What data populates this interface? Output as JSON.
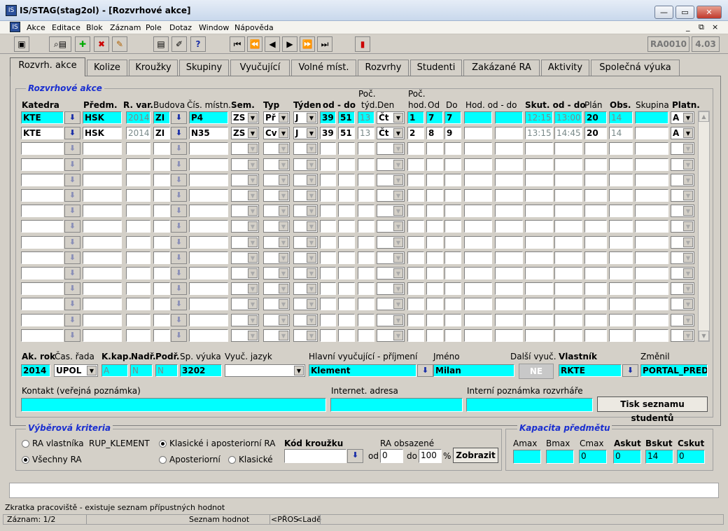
{
  "window": {
    "title": "IS/STAG(stag2ol) - [Rozvrhové akce]"
  },
  "menu": [
    "Akce",
    "Editace",
    "Blok",
    "Záznam",
    "Pole",
    "Dotaz",
    "Window",
    "Nápověda"
  ],
  "toolbar": {
    "form_code": "RA0010",
    "version": "4.03"
  },
  "tabs": [
    "Rozvrh. akce",
    "Kolize",
    "Kroužky",
    "Skupiny",
    "Vyučující",
    "Volné míst.",
    "Rozvrhy",
    "Studenti",
    "Zakázané RA",
    "Aktivity",
    "Společná výuka"
  ],
  "section": {
    "title": "Rozvrhové akce"
  },
  "columns": {
    "katedra": "Katedra",
    "predm": "Předm.",
    "rvar": "R. var.",
    "budova": "Budova",
    "cis_mistn": "Čís. místn.",
    "sem": "Sem.",
    "typ": "Typ",
    "tyden": "Týden",
    "od_do": "od - do",
    "poc_tyd_1": "Poč.",
    "poc_tyd_2": "týd.",
    "den": "Den",
    "poc_hod_1": "Poč.",
    "poc_hod_2": "hod.",
    "od": "Od",
    "do": "Do",
    "hod_od_do": "Hod. od - do",
    "skut": "Skut. od - do",
    "plan": "Plán",
    "obs": "Obs.",
    "skupina": "Skupina",
    "platn": "Platn."
  },
  "rows": [
    {
      "katedra": "KTE",
      "predm": "HSK",
      "rvar": "2014",
      "budova": "ZI",
      "mistn": "P4",
      "sem": "ZS",
      "typ": "Př",
      "tyden": "J",
      "od": "39",
      "do": "51",
      "poc_tyd": "13",
      "den": "Čt",
      "poc_hod": "1",
      "h_od": "7",
      "h_do": "7",
      "skut_od": "12:15",
      "skut_do": "13:00",
      "plan": "20",
      "obs": "14",
      "platn": "A"
    },
    {
      "katedra": "KTE",
      "predm": "HSK",
      "rvar": "2014",
      "budova": "ZI",
      "mistn": "N35",
      "sem": "ZS",
      "typ": "Cv",
      "tyden": "J",
      "od": "39",
      "do": "51",
      "poc_tyd": "13",
      "den": "Čt",
      "poc_hod": "2",
      "h_od": "8",
      "h_do": "9",
      "skut_od": "13:15",
      "skut_do": "14:45",
      "plan": "20",
      "obs": "14",
      "platn": "A"
    }
  ],
  "detail": {
    "labels": {
      "ak_rok": "Ak. rok",
      "cas_rada": "Čas. řada",
      "kkap": "K.kap.",
      "nadr": "Nadř.",
      "podr": "Podř.",
      "sp_vyuka": "Sp. výuka",
      "vyuc_jazyk": "Vyuč. jazyk",
      "hlavni": "Hlavní vyučující - příjmení",
      "jmeno": "Jméno",
      "dalsi": "Další vyuč.",
      "vlastnik": "Vlastník",
      "zmenil": "Změnil",
      "kontakt": "Kontakt (veřejná poznámka)",
      "internet": "Internet. adresa",
      "interni": "Interní poznámka rozvrháře"
    },
    "values": {
      "ak_rok": "2014",
      "cas_rada": "UPOL",
      "kkap": "A",
      "nadr": "N",
      "podr": "N",
      "sp_vyuka": "3202",
      "prijmeni": "Klement",
      "jmeno": "Milan",
      "dalsi_btn": "NE",
      "vlastnik": "RKTE",
      "zmenil": "PORTAL_PRED"
    },
    "print_button": "Tisk seznamu studentů"
  },
  "criteria": {
    "title": "Výběrová kriteria",
    "ra_vlastnika": "RA vlastníka",
    "rup": "RUP_KLEMENT",
    "vsechny": "Všechny RA",
    "klasicke_i_apost": "Klasické i aposteriorní RA",
    "aposteriorni": "Aposteriorní",
    "klasicke": "Klasické",
    "kod_krouzku": "Kód kroužku",
    "ra_obsazene": "RA obsazené",
    "od_label": "od",
    "od_value": "0",
    "do_label": "do",
    "do_value": "100",
    "pct": "%",
    "zobrazit": "Zobrazit"
  },
  "capacity": {
    "title": "Kapacita předmětu",
    "labels": [
      "Amax",
      "Bmax",
      "Cmax",
      "Askut",
      "Bskut",
      "Cskut"
    ],
    "values": [
      "",
      "",
      "0",
      "0",
      "14",
      "0"
    ]
  },
  "status": {
    "hint": "Zkratka pracoviště - existuje seznam přípustných hodnot",
    "zaznam": "Záznam: 1/2",
    "seznam": "Seznam hodnot",
    "pros": "<PŘOS",
    "lade": "<Ladě"
  }
}
